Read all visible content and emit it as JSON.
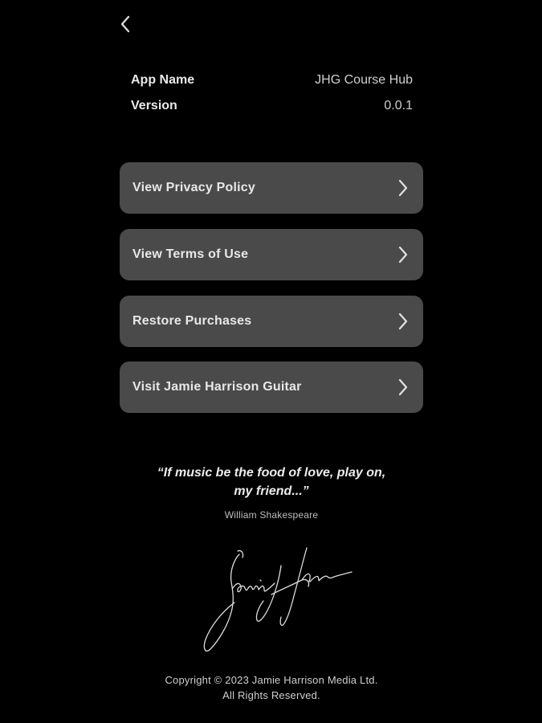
{
  "header": {
    "back_icon": "chevron-left-icon"
  },
  "app_info": {
    "app_name_label": "App Name",
    "app_name_value": "JHG Course Hub",
    "version_label": "Version",
    "version_value": "0.0.1"
  },
  "menu": {
    "items": [
      {
        "label": "View Privacy Policy",
        "icon": "chevron-right-icon"
      },
      {
        "label": "View Terms of Use",
        "icon": "chevron-right-icon"
      },
      {
        "label": "Restore Purchases",
        "icon": "chevron-right-icon"
      },
      {
        "label": "Visit Jamie Harrison Guitar",
        "icon": "chevron-right-icon"
      }
    ]
  },
  "quote": {
    "line1": "“If music be the food of love, play on,",
    "line2": "my friend...”",
    "author": "William Shakespeare"
  },
  "signature": {
    "text": "Jamie Harrison",
    "icon": "signature-image"
  },
  "footer": {
    "copyright_line1": "Copyright © 2023 Jamie Harrison Media Ltd.",
    "copyright_line2": "All Rights Reserved."
  },
  "colors": {
    "background": "#000000",
    "button_background": "#4a4a4a",
    "text_primary": "#e8e8e8"
  }
}
